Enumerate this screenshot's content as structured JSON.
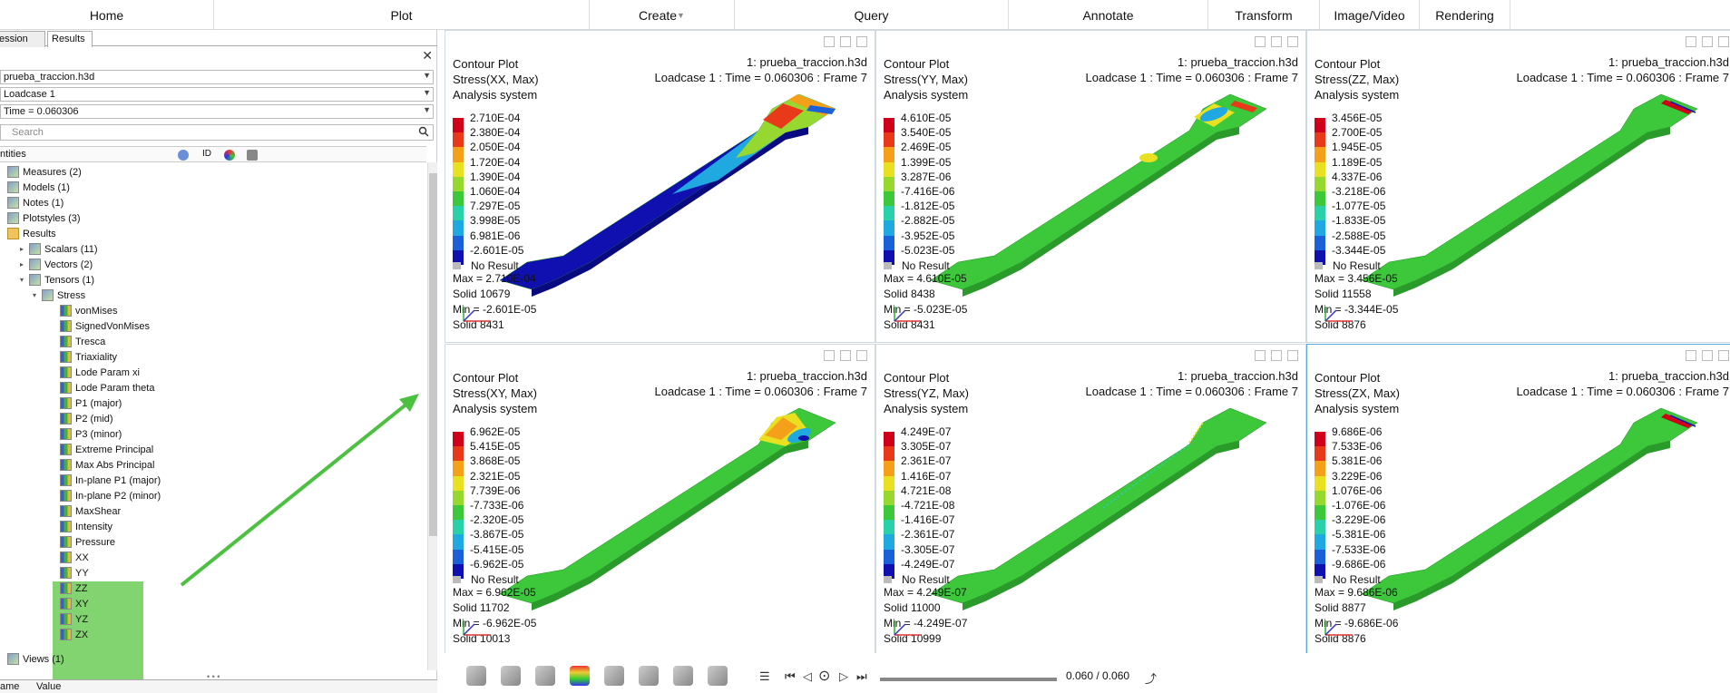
{
  "menu": {
    "items": [
      "Home",
      "Plot",
      "Create",
      "Query",
      "Annotate",
      "Transform",
      "Image/Video",
      "Rendering"
    ]
  },
  "left_panel": {
    "tabs": [
      "ession",
      "Results"
    ],
    "file_dropdown": "prueba_traccion.h3d",
    "loadcase_dropdown": "Loadcase 1",
    "time_dropdown": "Time = 0.060306",
    "search_placeholder": "Search",
    "column_header": "ntities",
    "id_label": "ID",
    "tree": [
      {
        "label": "Measures (2)",
        "indent": 0,
        "icon": "measures-icon"
      },
      {
        "label": "Models (1)",
        "indent": 0,
        "icon": "models-icon"
      },
      {
        "label": "Notes (1)",
        "indent": 0,
        "icon": "notes-icon"
      },
      {
        "label": "Plotstyles (3)",
        "indent": 0,
        "icon": "plotstyles-icon"
      },
      {
        "label": "Results",
        "indent": 0,
        "icon": "folder-icon"
      },
      {
        "label": "Scalars (11)",
        "indent": 1,
        "icon": "scalars-icon"
      },
      {
        "label": "Vectors (2)",
        "indent": 1,
        "icon": "vectors-icon"
      },
      {
        "label": "Tensors (1)",
        "indent": 1,
        "icon": "tensors-icon"
      },
      {
        "label": "Stress",
        "indent": 2,
        "icon": "stress-icon"
      },
      {
        "label": "vonMises",
        "indent": 3,
        "icon": "result-icon"
      },
      {
        "label": "SignedVonMises",
        "indent": 3,
        "icon": "result-icon"
      },
      {
        "label": "Tresca",
        "indent": 3,
        "icon": "result-icon"
      },
      {
        "label": "Triaxiality",
        "indent": 3,
        "icon": "result-icon"
      },
      {
        "label": "Lode Param xi",
        "indent": 3,
        "icon": "result-icon"
      },
      {
        "label": "Lode Param theta",
        "indent": 3,
        "icon": "result-icon"
      },
      {
        "label": "P1 (major)",
        "indent": 3,
        "icon": "result-icon"
      },
      {
        "label": "P2 (mid)",
        "indent": 3,
        "icon": "result-icon"
      },
      {
        "label": "P3 (minor)",
        "indent": 3,
        "icon": "result-icon"
      },
      {
        "label": "Extreme Principal",
        "indent": 3,
        "icon": "result-icon"
      },
      {
        "label": "Max Abs Principal",
        "indent": 3,
        "icon": "result-icon"
      },
      {
        "label": "In-plane P1 (major)",
        "indent": 3,
        "icon": "result-icon"
      },
      {
        "label": "In-plane P2 (minor)",
        "indent": 3,
        "icon": "result-icon"
      },
      {
        "label": "MaxShear",
        "indent": 3,
        "icon": "result-icon"
      },
      {
        "label": "Intensity",
        "indent": 3,
        "icon": "result-icon"
      },
      {
        "label": "Pressure",
        "indent": 3,
        "icon": "result-icon"
      },
      {
        "label": "XX",
        "indent": 3,
        "icon": "result-icon"
      },
      {
        "label": "YY",
        "indent": 3,
        "icon": "result-icon"
      },
      {
        "label": "ZZ",
        "indent": 3,
        "icon": "result-icon"
      },
      {
        "label": "XY",
        "indent": 3,
        "icon": "result-icon"
      },
      {
        "label": "YZ",
        "indent": 3,
        "icon": "result-icon"
      },
      {
        "label": "ZX",
        "indent": 3,
        "icon": "result-icon"
      },
      {
        "label": "Views (1)",
        "indent": 0,
        "icon": "views-icon"
      }
    ],
    "bottom_columns": [
      "ame",
      "Value"
    ]
  },
  "colors": {
    "legend": [
      "#d0001a",
      "#e83a1a",
      "#f5a01a",
      "#e8e020",
      "#96d830",
      "#3cc83a",
      "#2ad0a8",
      "#20a8e0",
      "#1a60d8",
      "#1010b0"
    ],
    "highlight": "#6ccd57",
    "specimen_green": "#3cc83a",
    "arrow": "#4cc040"
  },
  "panels": [
    {
      "title": "Contour Plot",
      "result": "Stress(XX, Max)",
      "system": "Analysis system",
      "file": "1: prueba_traccion.h3d",
      "loadcase": "Loadcase 1 : Time = 0.060306 : Frame 7",
      "legend": [
        "2.710E-04",
        "2.380E-04",
        "2.050E-04",
        "1.720E-04",
        "1.390E-04",
        "1.060E-04",
        "7.297E-05",
        "3.998E-05",
        "6.981E-06",
        "-2.601E-05"
      ],
      "no_result": "No Result",
      "max": "Max = 2.710E-04",
      "max_elem": "Solid 10679",
      "min": "Min = -2.601E-05",
      "min_elem": "Solid 8431",
      "variant": "xx"
    },
    {
      "title": "Contour Plot",
      "result": "Stress(YY, Max)",
      "system": "Analysis system",
      "file": "1: prueba_traccion.h3d",
      "loadcase": "Loadcase 1 : Time = 0.060306 : Frame 7",
      "legend": [
        "4.610E-05",
        "3.540E-05",
        "2.469E-05",
        "1.399E-05",
        "3.287E-06",
        "-7.416E-06",
        "-1.812E-05",
        "-2.882E-05",
        "-3.952E-05",
        "-5.023E-05"
      ],
      "no_result": "No Result",
      "max": "Max = 4.610E-05",
      "max_elem": "Solid 8438",
      "min": "Min = -5.023E-05",
      "min_elem": "Solid 8431",
      "variant": "yy"
    },
    {
      "title": "Contour Plot",
      "result": "Stress(ZZ, Max)",
      "system": "Analysis system",
      "file": "1: prueba_traccion.h3d",
      "loadcase": "Loadcase 1 : Time = 0.060306 : Frame 7",
      "legend": [
        "3.456E-05",
        "2.700E-05",
        "1.945E-05",
        "1.189E-05",
        "4.337E-06",
        "-3.218E-06",
        "-1.077E-05",
        "-1.833E-05",
        "-2.588E-05",
        "-3.344E-05"
      ],
      "no_result": "No Result",
      "max": "Max = 3.456E-05",
      "max_elem": "Solid 11558",
      "min": "Min = -3.344E-05",
      "min_elem": "Solid 8876",
      "variant": "zz"
    },
    {
      "title": "Contour Plot",
      "result": "Stress(XY, Max)",
      "system": "Analysis system",
      "file": "1: prueba_traccion.h3d",
      "loadcase": "Loadcase 1 : Time = 0.060306 : Frame 7",
      "legend": [
        "6.962E-05",
        "5.415E-05",
        "3.868E-05",
        "2.321E-05",
        "7.739E-06",
        "-7.733E-06",
        "-2.320E-05",
        "-3.867E-05",
        "-5.415E-05",
        "-6.962E-05"
      ],
      "no_result": "No Result",
      "max": "Max = 6.962E-05",
      "max_elem": "Solid 11702",
      "min": "Min = -6.962E-05",
      "min_elem": "Solid 10013",
      "variant": "xy"
    },
    {
      "title": "Contour Plot",
      "result": "Stress(YZ, Max)",
      "system": "Analysis system",
      "file": "1: prueba_traccion.h3d",
      "loadcase": "Loadcase 1 : Time = 0.060306 : Frame 7",
      "legend": [
        "4.249E-07",
        "3.305E-07",
        "2.361E-07",
        "1.416E-07",
        "4.721E-08",
        "-4.721E-08",
        "-1.416E-07",
        "-2.361E-07",
        "-3.305E-07",
        "-4.249E-07"
      ],
      "no_result": "No Result",
      "max": "Max = 4.249E-07",
      "max_elem": "Solid 11000",
      "min": "Min = -4.249E-07",
      "min_elem": "Solid 10999",
      "variant": "yz"
    },
    {
      "title": "Contour Plot",
      "result": "Stress(ZX, Max)",
      "system": "Analysis system",
      "file": "1: prueba_traccion.h3d",
      "loadcase": "Loadcase 1 : Time = 0.060306 : Frame 7",
      "legend": [
        "9.686E-06",
        "7.533E-06",
        "5.381E-06",
        "3.229E-06",
        "1.076E-06",
        "-1.076E-06",
        "-3.229E-06",
        "-5.381E-06",
        "-7.533E-06",
        "-9.686E-06"
      ],
      "no_result": "No Result",
      "max": "Max = 9.686E-06",
      "max_elem": "Solid 8877",
      "min": "Min = -9.686E-06",
      "min_elem": "Solid 8876",
      "variant": "zx"
    }
  ],
  "animation": {
    "frame_label": "0.060 / 0.060"
  }
}
